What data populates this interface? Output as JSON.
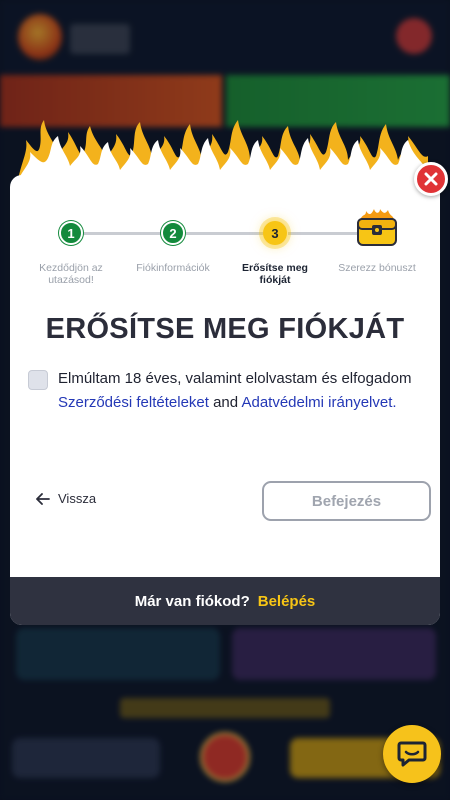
{
  "colors": {
    "accent_yellow": "#f7c515",
    "done_green": "#138a3c",
    "link_blue": "#2438b6",
    "close_red": "#e03336",
    "footer_bg": "#2f3240"
  },
  "stepper": {
    "steps": [
      {
        "number": "1",
        "label": "Kezdődjön az utazásod!",
        "state": "done"
      },
      {
        "number": "2",
        "label": "Fiókinformációk",
        "state": "done"
      },
      {
        "number": "3",
        "label": "Erősítse meg fiókját",
        "state": "active"
      },
      {
        "number": "",
        "label": "Szerezz bónuszt",
        "state": "pending",
        "icon": "treasure-chest-icon"
      }
    ]
  },
  "modal": {
    "title": "ERŐSÍTSE MEG FIÓKJÁT",
    "consent": {
      "checked": false,
      "text_before": "Elmúltam 18 éves, valamint elolvastam és elfogadom ",
      "terms_link": "Szerződési feltételeket",
      "text_middle": " and ",
      "privacy_link": "Adatvédelmi irányelvet.",
      "text_after": ""
    },
    "back_label": "Vissza",
    "finish_label": "Befejezés"
  },
  "footer": {
    "question": "Már van fiókod?",
    "login_label": "Belépés"
  },
  "icons": {
    "close": "close-icon",
    "back": "arrow-left-icon",
    "chat": "chat-bubble-icon"
  }
}
